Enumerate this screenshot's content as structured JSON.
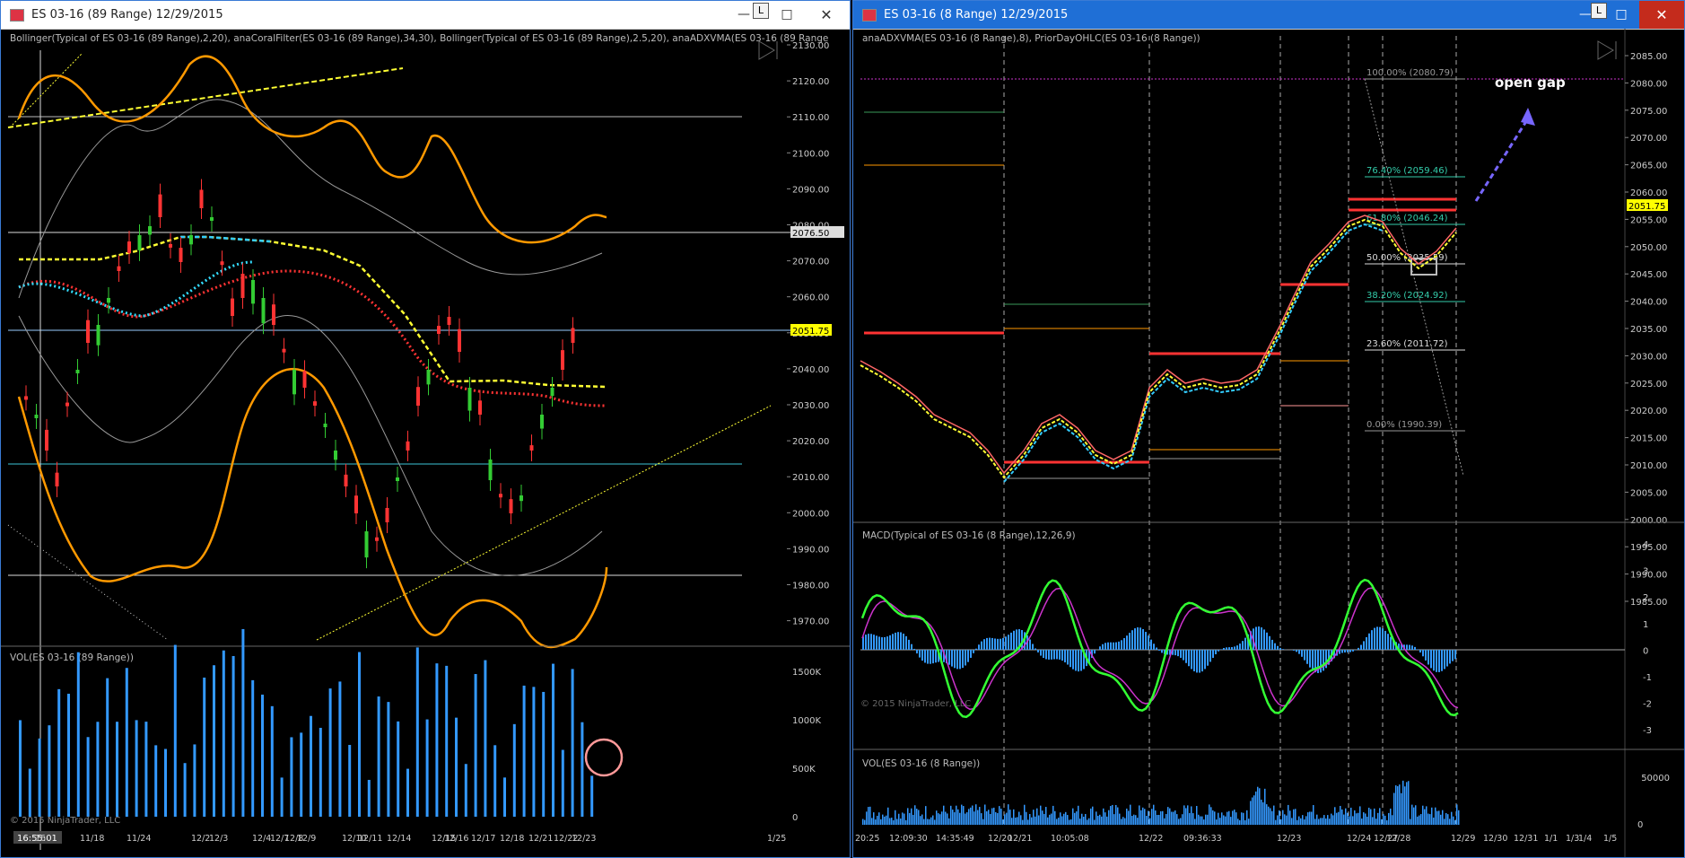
{
  "left": {
    "title": "ES 03-16 (89 Range)   12/29/2015",
    "indicators_label": "Bollinger(Typical of ES 03-16 (89 Range),2,20), anaCoralFilter(ES 03-16 (89 Range),34,30), Bollinger(Typical of ES 03-16 (89 Range),2.5,20), anaADXVMA(ES 03-16 (89 Range",
    "price_ticks": [
      "2130.00",
      "2120.00",
      "2110.00",
      "2100.00",
      "2090.00",
      "2080.00",
      "2070.00",
      "2060.00",
      "2050.00",
      "2040.00",
      "2030.00",
      "2020.00",
      "2010.00",
      "2000.00",
      "1990.00",
      "1980.00",
      "1970.00"
    ],
    "price_flag_2076": "2076.50",
    "price_flag_2051": "2051.75",
    "vol_label": "VOL(ES 03-16 (89 Range))",
    "vol_ticks": [
      "1500K",
      "1000K",
      "500K",
      "0"
    ],
    "copyright": "© 2015 NinjaTrader, LLC",
    "time_tag": "16:55:01",
    "date_ticks": [
      "16",
      "11/18",
      "11/24",
      "12/2",
      "12/3",
      "12/4",
      "12/7",
      "12/8",
      "12/9",
      "12/10",
      "12/11",
      "12/14",
      "12/15",
      "12/16",
      "12/17",
      "12/18",
      "12/21",
      "12/22",
      "12/23",
      "1/25"
    ],
    "l_button": "L"
  },
  "right": {
    "title": "ES 03-16 (8 Range)   12/29/2015",
    "indicators_label": "anaADXVMA(ES 03-16 (8 Range),8), PriorDayOHLC(ES 03-16 (8 Range))",
    "price_ticks": [
      "2085.00",
      "2080.00",
      "2075.00",
      "2070.00",
      "2065.00",
      "2060.00",
      "2055.00",
      "2050.00",
      "2045.00",
      "2040.00",
      "2035.00",
      "2030.00",
      "2025.00",
      "2020.00",
      "2015.00",
      "2010.00",
      "2005.00",
      "2000.00",
      "1995.00",
      "1990.00",
      "1985.00"
    ],
    "price_flag": "2051.75",
    "fib": [
      "100.00% (2080.79)",
      "76.40% (2059.46)",
      "61.80% (2046.24)",
      "50.00% (2035.59)",
      "38.20% (2024.92)",
      "23.60% (2011.72)",
      "0.00% (1990.39)"
    ],
    "annotation": "open gap",
    "macd_label": "MACD(Typical of ES 03-16 (8 Range),12,26,9)",
    "macd_ticks": [
      "4",
      "3",
      "2",
      "1",
      "0",
      "-1",
      "-2",
      "-3"
    ],
    "vol_label": "VOL(ES 03-16 (8 Range))",
    "vol_ticks": [
      "50000",
      "0"
    ],
    "copyright": "© 2015 NinjaTrader, LLC",
    "time_ticks": [
      "20:25",
      "12:09:30",
      "14:35:49",
      "12/20",
      "12/21",
      "10:05:08",
      "12/22",
      "09:36:33",
      "12/23",
      "12/24",
      "12/27",
      "12/28",
      "12/29",
      "12/30",
      "12/31",
      "1/1",
      "1/3",
      "1/4",
      "1/5"
    ],
    "l_button": "L"
  },
  "window_controls": {
    "minimize": "—",
    "maximize": "□",
    "close": "✕"
  },
  "colors": {
    "bollinger": "#ff9900",
    "adxvma": "#ffff00",
    "coral": "#ff3b30",
    "macd": "#33ff33",
    "volume": "#3399ff",
    "gap_line": "#cc33cc"
  }
}
